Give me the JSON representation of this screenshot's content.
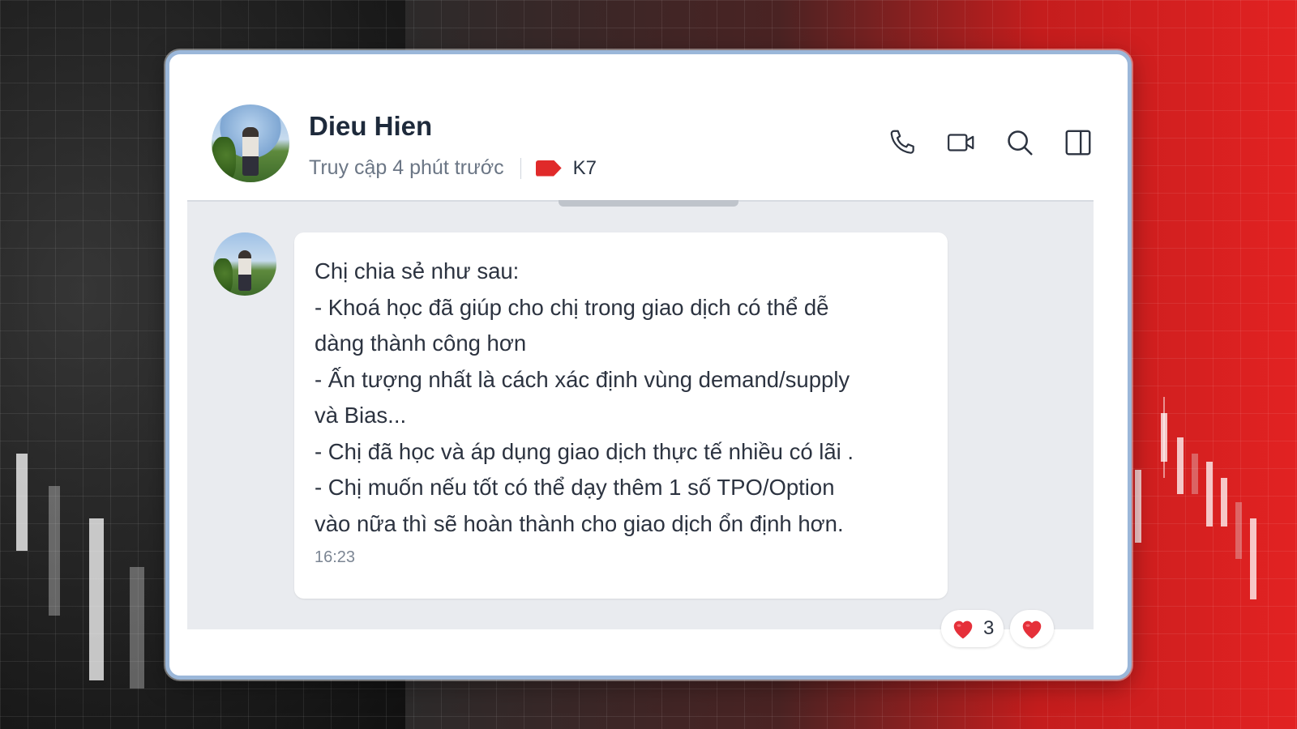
{
  "contact": {
    "name": "Dieu Hien",
    "status": "Truy cập 4 phút trước",
    "tag": "K7",
    "tag_color": "#e02a2a"
  },
  "toolbar": {
    "icons": [
      "phone-icon",
      "video-call-icon",
      "search-icon",
      "side-panel-icon"
    ]
  },
  "message": {
    "lines": [
      "Chị chia sẻ như sau:",
      "- Khoá học đã giúp cho chị trong giao dịch có thể dễ",
      "dàng thành công hơn",
      "- Ấn tượng nhất là cách xác định vùng demand/supply",
      "và Bias...",
      "- Chị đã học và áp dụng giao dịch thực tế nhiều có lãi .",
      "- Chị muốn nếu tốt có thể dạy thêm 1 số TPO/Option",
      "vào nữa thì sẽ hoàn thành cho giao dịch ổn định hơn."
    ],
    "time": "16:23"
  },
  "reactions": {
    "summary_count": "3",
    "heart_color": "#e5303a"
  }
}
